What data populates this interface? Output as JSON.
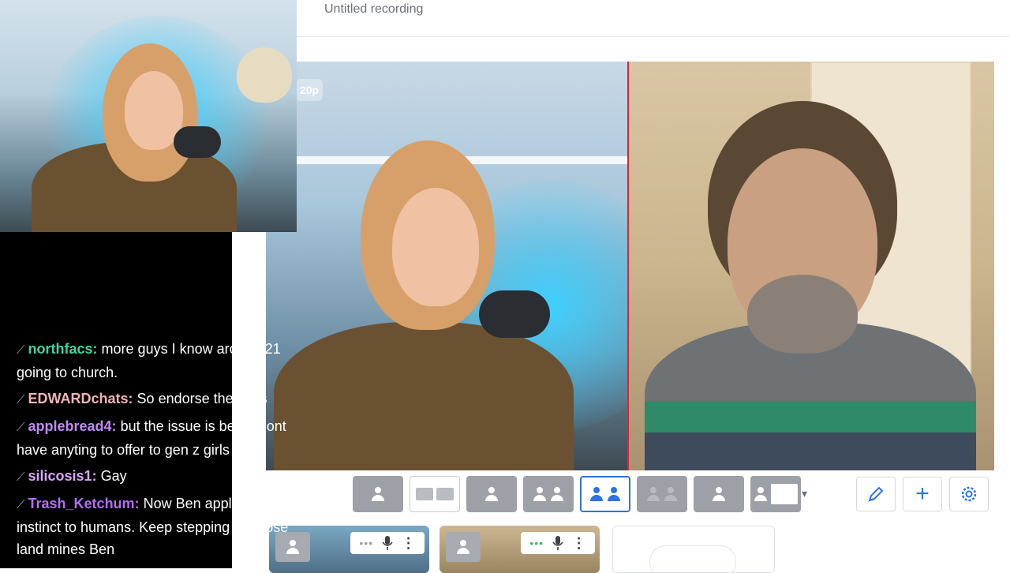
{
  "studio": {
    "title": "Untitled recording"
  },
  "stage": {
    "resolution_badge": "20p"
  },
  "layout_options": [
    {
      "name": "solo-layout",
      "state": "grey"
    },
    {
      "name": "group-layout",
      "state": "white"
    },
    {
      "name": "pip-layout",
      "state": "grey"
    },
    {
      "name": "leader-layout",
      "state": "grey"
    },
    {
      "name": "split-layout",
      "state": "active"
    },
    {
      "name": "split-grey-layout",
      "state": "grey"
    },
    {
      "name": "screen-layout",
      "state": "grey"
    },
    {
      "name": "list-layout",
      "state": "grey"
    }
  ],
  "toolbar": {
    "edit_icon": "pencil-icon",
    "add_icon": "plus-icon",
    "settings_icon": "gear-icon",
    "accent": "#2f72e4"
  },
  "participants": [
    {
      "icon": "person-icon"
    },
    {
      "icon": "person-icon"
    }
  ],
  "chat": {
    "messages": [
      {
        "badge": "⟋",
        "user": "northfacs:",
        "color": "#3dd6a3",
        "text": "more guys I know around 21 going to church."
      },
      {
        "badge": "⟋",
        "user": "EDWARDchats:",
        "color": "#f0b4b4",
        "text": "So endorse the gays"
      },
      {
        "badge": "⟋",
        "user": "applebread4:",
        "color": "#c08bf2",
        "text": "but the issue is ben u dont have anyting to offer to gen z girls"
      },
      {
        "badge": "⟋",
        "user": "silicosis1:",
        "color": "#d9a6ff",
        "text": "Gay"
      },
      {
        "badge": "⟋",
        "user": "Trash_Ketchum:",
        "color": "#b56cf5",
        "text": "Now Ben applies monkey instinct to humans. Keep stepping on those land mines Ben"
      }
    ]
  }
}
